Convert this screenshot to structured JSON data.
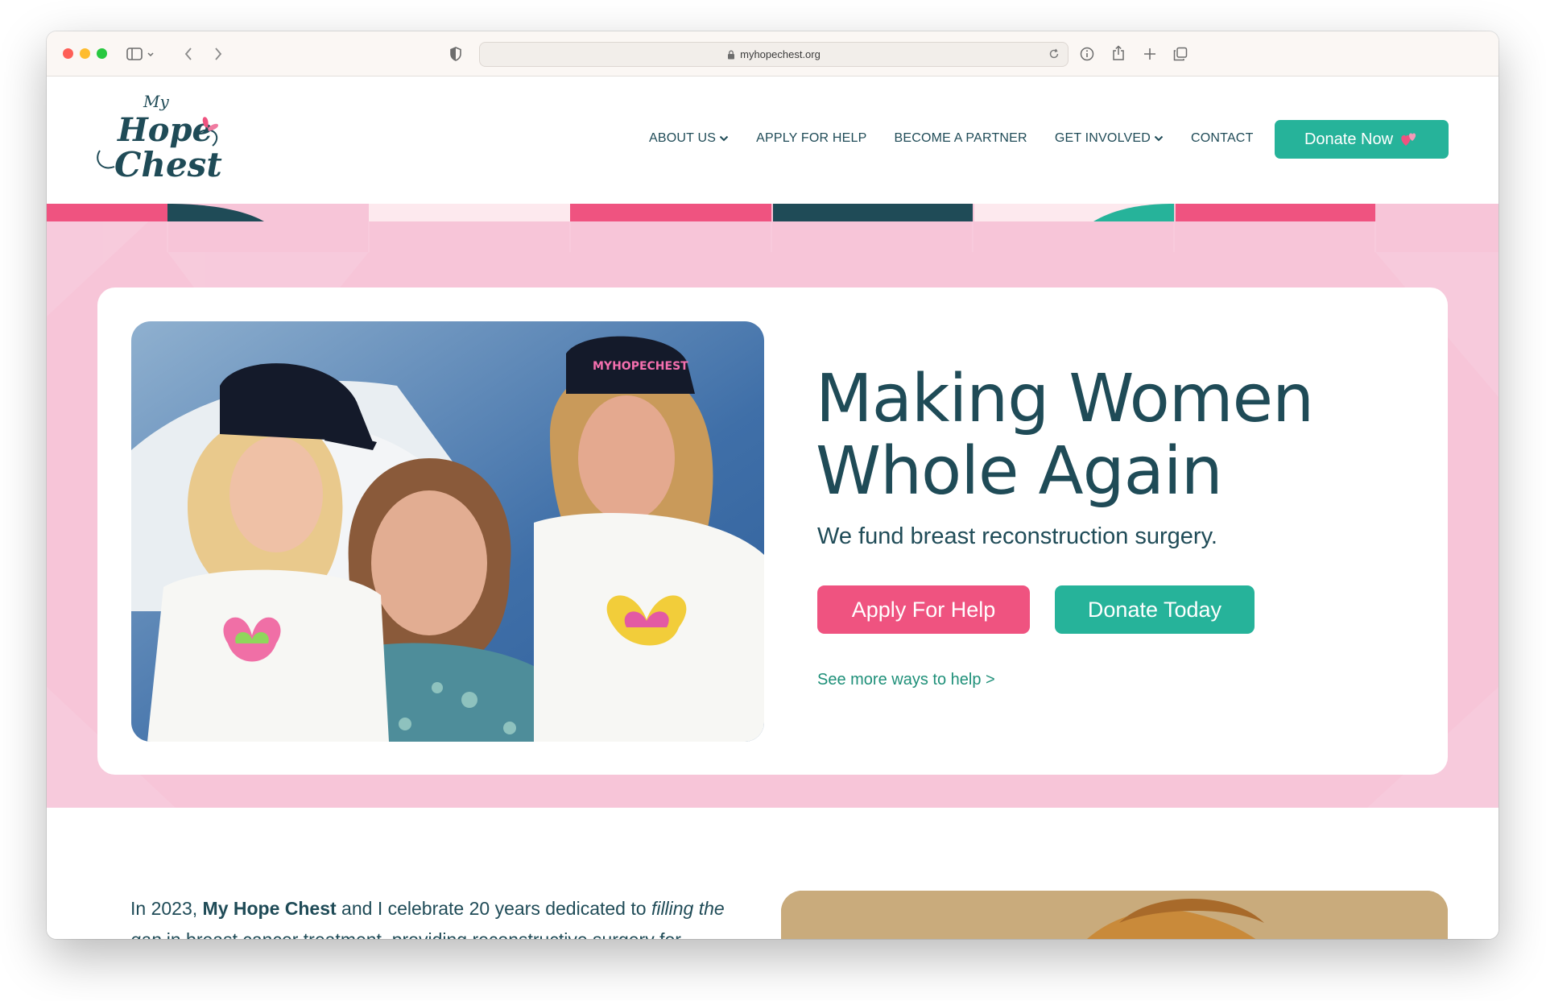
{
  "browser": {
    "url": "myhopechest.org",
    "traffic_lights": [
      "#fe5f57",
      "#febc2e",
      "#28c840"
    ]
  },
  "site": {
    "logo": {
      "line1": "My",
      "line2": "Hope",
      "line3": "Chest"
    },
    "nav": [
      {
        "label": "ABOUT US",
        "has_dropdown": true
      },
      {
        "label": "APPLY FOR HELP",
        "has_dropdown": false
      },
      {
        "label": "BECOME A PARTNER",
        "has_dropdown": false
      },
      {
        "label": "GET INVOLVED",
        "has_dropdown": true
      },
      {
        "label": "CONTACT",
        "has_dropdown": false
      }
    ],
    "donate_now": {
      "label": "Donate Now",
      "icon": "hearts-icon"
    }
  },
  "hero": {
    "title_line1": "Making Women",
    "title_line2": "Whole Again",
    "subtitle": "We fund breast reconstruction surgery.",
    "apply_button": "Apply For Help",
    "donate_button": "Donate Today",
    "more_link": "See more ways to help >",
    "photo_hat_text": "MYHOPECHEST"
  },
  "intro": {
    "year_prefix": "In 2023, ",
    "org_name": "My Hope Chest",
    "after_name": " and I celebrate 20 years dedicated to ",
    "emphasis": "filling the gap",
    "after_emphasis": " in breast cancer treatment, providing reconstructive surgery for uninsured and underinsured breast cancer survivors."
  },
  "colors": {
    "teal": "#26b39a",
    "pink": "#ef5380",
    "navy": "#1f4b57",
    "hero_bg": "#f7c5d8"
  }
}
